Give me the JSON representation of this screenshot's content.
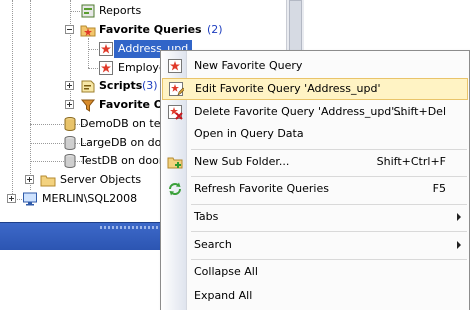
{
  "tree": {
    "items": [
      {
        "label": "Reports"
      },
      {
        "label": "Favorite Queries",
        "count": "(2)"
      },
      {
        "label": "Address_upd"
      },
      {
        "label": "Employee"
      },
      {
        "label": "Scripts",
        "count": "(3)"
      },
      {
        "label": "Favorite Ob"
      },
      {
        "label": "DemoDB on testi"
      },
      {
        "label": "LargeDB on door"
      },
      {
        "label": "TestDB on door"
      },
      {
        "label": "Server Objects"
      },
      {
        "label": "MERLIN\\SQL2008"
      }
    ]
  },
  "menu": {
    "items": [
      {
        "label": "New Favorite Query",
        "shortcut": "",
        "icon": "new-favorite-query-icon"
      },
      {
        "label": "Edit Favorite Query 'Address_upd'",
        "shortcut": "",
        "icon": "edit-favorite-query-icon",
        "highlighted": true
      },
      {
        "label": "Delete Favorite Query 'Address_upd'...",
        "shortcut": "Shift+Del",
        "icon": "delete-favorite-query-icon"
      },
      {
        "label": "Open in Query Data",
        "shortcut": ""
      },
      {
        "label": "New Sub Folder...",
        "shortcut": "Shift+Ctrl+F",
        "icon": "new-folder-icon"
      },
      {
        "label": "Refresh Favorite Queries",
        "shortcut": "F5",
        "icon": "refresh-icon"
      },
      {
        "label": "Tabs",
        "shortcut": "",
        "submenu": true
      },
      {
        "label": "Search",
        "shortcut": "",
        "submenu": true
      },
      {
        "label": "Collapse All",
        "shortcut": ""
      },
      {
        "label": "Expand All",
        "shortcut": ""
      }
    ]
  },
  "colors": {
    "selection": "#3165c8",
    "menu_highlight": "#fff3c4",
    "count_text": "#1f3fbf",
    "panel_bar": "#2c55b2"
  }
}
